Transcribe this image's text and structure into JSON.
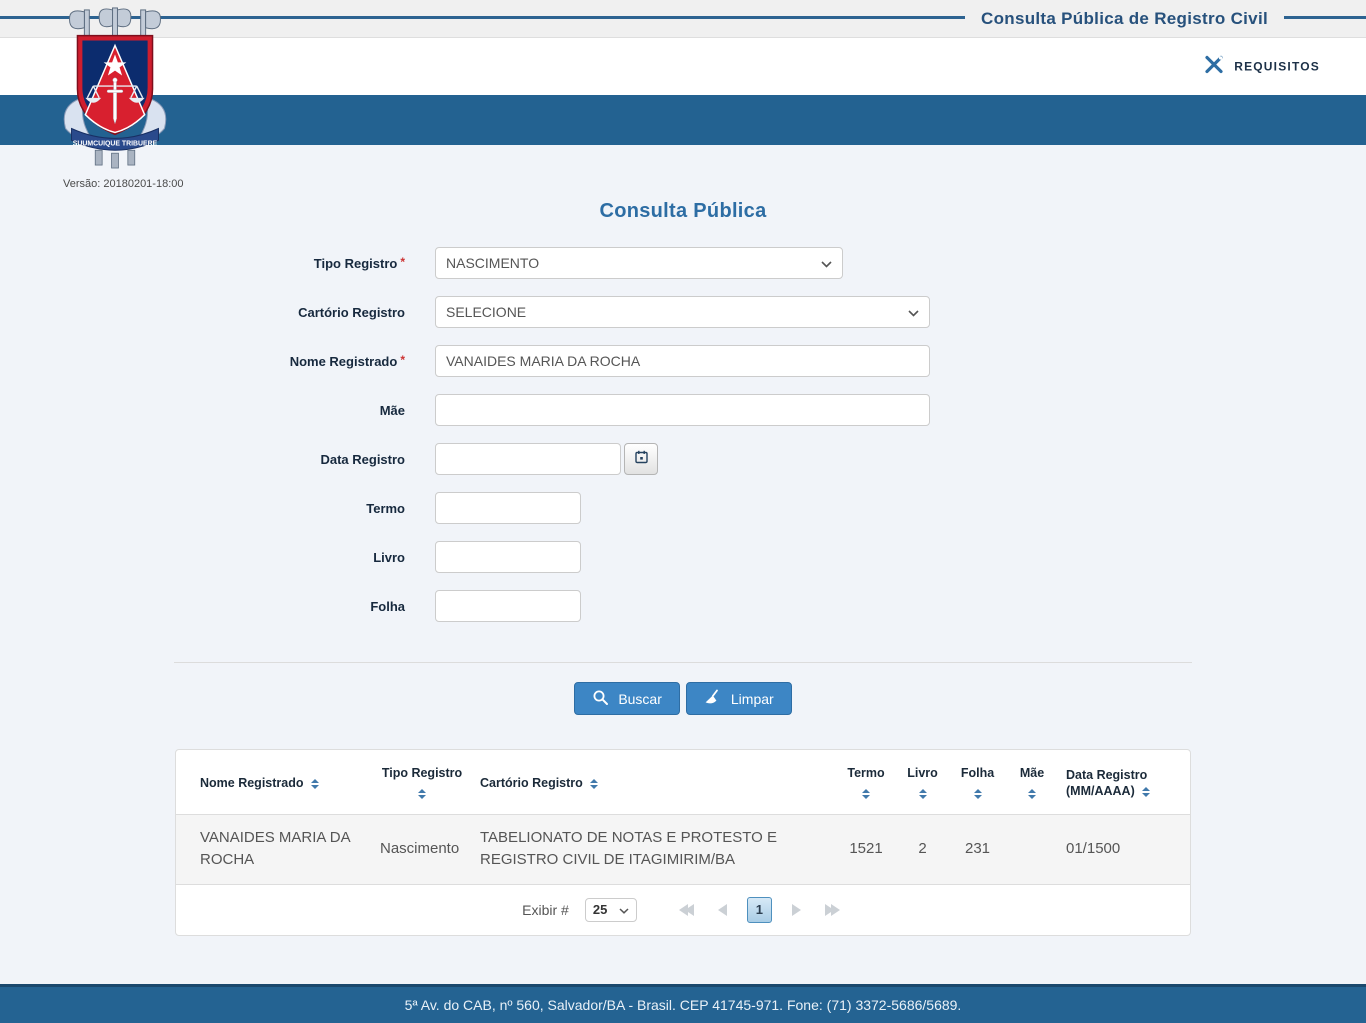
{
  "header": {
    "title": "Consulta Pública de Registro Civil",
    "requisitos_label": "REQUISITOS",
    "version": "Versão: 20180201-18:00",
    "motto": "SUUMCUIQUE TRIBUERE"
  },
  "form": {
    "title": "Consulta Pública",
    "required_marker": "*",
    "fields": {
      "tipo_registro": {
        "label": "Tipo Registro",
        "required": true,
        "value": "NASCIMENTO"
      },
      "cartorio_registro": {
        "label": "Cartório Registro",
        "required": false,
        "value": "SELECIONE"
      },
      "nome_registrado": {
        "label": "Nome Registrado",
        "required": true,
        "value": "VANAIDES MARIA DA ROCHA"
      },
      "mae": {
        "label": "Mãe",
        "value": ""
      },
      "data_registro": {
        "label": "Data Registro",
        "value": ""
      },
      "termo": {
        "label": "Termo",
        "value": ""
      },
      "livro": {
        "label": "Livro",
        "value": ""
      },
      "folha": {
        "label": "Folha",
        "value": ""
      }
    },
    "buttons": {
      "buscar": "Buscar",
      "limpar": "Limpar"
    }
  },
  "table": {
    "columns": [
      "Nome Registrado",
      "Tipo Registro",
      "Cartório Registro",
      "Termo",
      "Livro",
      "Folha",
      "Mãe",
      "Data Registro (MM/AAAA)"
    ],
    "rows": [
      {
        "nome": "VANAIDES MARIA DA ROCHA",
        "tipo": "Nascimento",
        "cartorio": "TABELIONATO DE NOTAS E PROTESTO E REGISTRO CIVIL DE ITAGIMIRIM/BA",
        "termo": "1521",
        "livro": "2",
        "folha": "231",
        "mae": "",
        "data": "01/1500"
      }
    ],
    "pagination": {
      "exibir_label": "Exibir #",
      "page_size": "25",
      "current_page": "1"
    }
  },
  "footer": {
    "address": "5ª Av. do CAB, nº 560, Salvador/BA - Brasil. CEP 41745-971. Fone: (71) 3372-5686/5689."
  },
  "colors": {
    "topbar_bg": "#f0f0f0",
    "line_blue": "#2d6391",
    "title_navy": "#27517c",
    "band_blue": "#236291",
    "page_bg": "#f1f4f9",
    "heading_blue": "#2d6da4",
    "label_navy": "#17293e",
    "required_red": "#cc3333",
    "button_blue": "#3d86c5",
    "button_border": "#2e6da4",
    "footer_blue": "#246392",
    "footer_border": "#1a486d",
    "sort_blue": "#4179ab",
    "icon_blue": "#2d6da3"
  }
}
